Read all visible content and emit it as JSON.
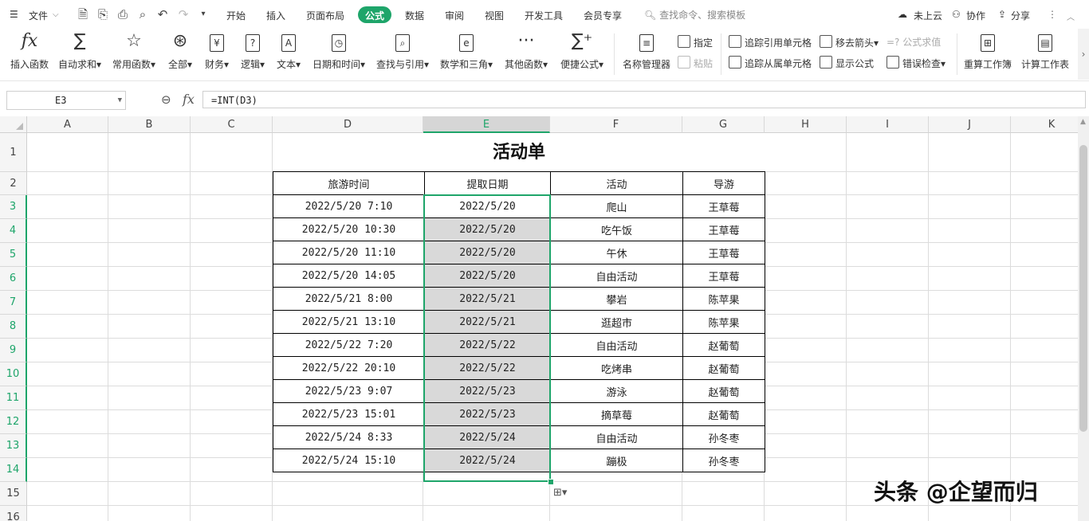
{
  "menubar": {
    "file": "文件",
    "tabs": [
      "开始",
      "插入",
      "页面布局",
      "公式",
      "数据",
      "审阅",
      "视图",
      "开发工具",
      "会员专享"
    ],
    "active_tab": "公式",
    "search_placeholder": "查找命令、搜索模板",
    "cloud": "未上云",
    "collab": "协作",
    "share": "分享"
  },
  "ribbon": {
    "insert_function": "插入函数",
    "autosum": "自动求和",
    "common_functions": "常用函数",
    "all": "全部",
    "finance": "财务",
    "logic": "逻辑",
    "text": "文本",
    "datetime": "日期和时间",
    "lookup": "查找与引用",
    "math": "数学和三角",
    "other": "其他函数",
    "quick_formula": "便捷公式",
    "name_manager": "名称管理器",
    "define": "指定",
    "paste": "粘贴",
    "trace_precedents": "追踪引用单元格",
    "trace_dependents": "追踪从属单元格",
    "remove_arrows": "移去箭头",
    "show_formulas": "显示公式",
    "formula_eval": "公式求值",
    "error_check": "错误检查",
    "recalc_workbook": "重算工作簿",
    "calc_sheet": "计算工作表",
    "accent_color": "#1ea56a"
  },
  "formula_bar": {
    "name_box": "E3",
    "fx": "fx",
    "formula": "=INT(D3)"
  },
  "grid": {
    "columns": [
      "A",
      "B",
      "C",
      "D",
      "E",
      "F",
      "G",
      "H",
      "I",
      "J",
      "K"
    ],
    "rows": [
      "1",
      "2",
      "3",
      "4",
      "5",
      "6",
      "7",
      "8",
      "9",
      "10",
      "11",
      "12",
      "13",
      "14",
      "15",
      "16"
    ],
    "selected_column": "E"
  },
  "sheet": {
    "title": "活动单",
    "headers": [
      "旅游时间",
      "提取日期",
      "活动",
      "导游"
    ],
    "rows": [
      [
        "2022/5/20 7:10",
        "2022/5/20",
        "爬山",
        "王草莓"
      ],
      [
        "2022/5/20 10:30",
        "2022/5/20",
        "吃午饭",
        "王草莓"
      ],
      [
        "2022/5/20 11:10",
        "2022/5/20",
        "午休",
        "王草莓"
      ],
      [
        "2022/5/20 14:05",
        "2022/5/20",
        "自由活动",
        "王草莓"
      ],
      [
        "2022/5/21 8:00",
        "2022/5/21",
        "攀岩",
        "陈苹果"
      ],
      [
        "2022/5/21 13:10",
        "2022/5/21",
        "逛超市",
        "陈苹果"
      ],
      [
        "2022/5/22 7:20",
        "2022/5/22",
        "自由活动",
        "赵葡萄"
      ],
      [
        "2022/5/22 20:10",
        "2022/5/22",
        "吃烤串",
        "赵葡萄"
      ],
      [
        "2022/5/23 9:07",
        "2022/5/23",
        "游泳",
        "赵葡萄"
      ],
      [
        "2022/5/23 15:01",
        "2022/5/23",
        "摘草莓",
        "赵葡萄"
      ],
      [
        "2022/5/24 8:33",
        "2022/5/24",
        "自由活动",
        "孙冬枣"
      ],
      [
        "2022/5/24 15:10",
        "2022/5/24",
        "蹦极",
        "孙冬枣"
      ]
    ]
  },
  "watermark": "头条 @企望而归"
}
